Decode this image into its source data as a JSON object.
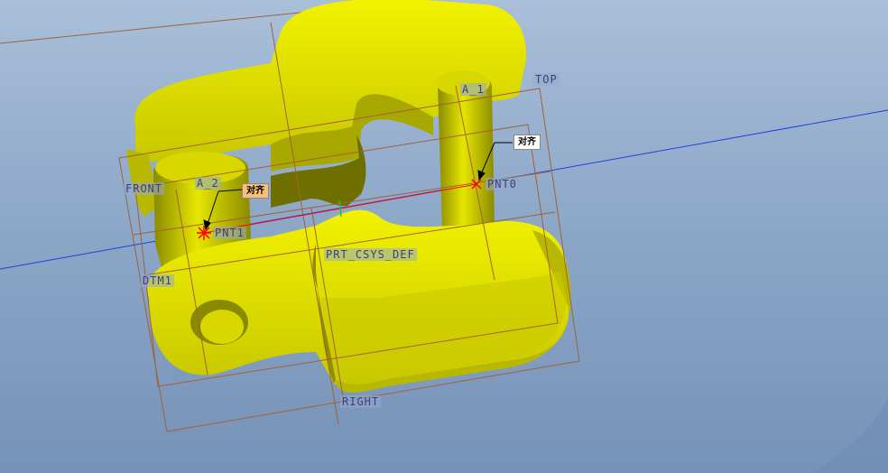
{
  "labels": {
    "top": "TOP",
    "front": "FRONT",
    "right": "RIGHT",
    "a1": "A_1",
    "a2": "A_2",
    "dtm1": "DTM1",
    "pnt0": "PNT0",
    "pnt1": "PNT1",
    "csys": "PRT_CSYS_DEF"
  },
  "notes": {
    "pnt0_note": "对齐",
    "pnt1_note": "对齐"
  },
  "colors": {
    "part_yellow": "#e0e000",
    "part_shadow": "#8f8f00",
    "datum_plane": "#a0623a",
    "axis_line": "#2040e0",
    "constraint_red": "#ff0000"
  }
}
